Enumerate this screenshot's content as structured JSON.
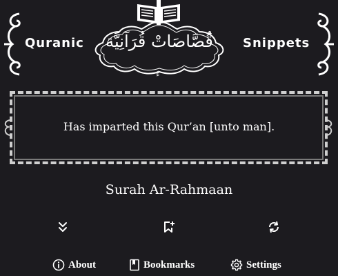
{
  "header": {
    "brand_left": "Quranic",
    "brand_right": "Snippets",
    "arabic_title": "قُصَّاصَاتْ قُرَآنِيَّة",
    "small_mark": "ءَ"
  },
  "verse": {
    "text": "Has imparted this Qur’an [unto man]."
  },
  "surah": {
    "name": "Surah Ar-Rahmaan"
  },
  "actions": {
    "scroll_down_icon": "chevrons-down-icon",
    "bookmark_add_icon": "bookmark-plus-icon",
    "refresh_icon": "refresh-icon"
  },
  "nav": {
    "about_label": "About",
    "bookmarks_label": "Bookmarks",
    "settings_label": "Settings"
  },
  "colors": {
    "background": "#1c1b1f",
    "text": "#ffffff",
    "frame": "#cfcfcf"
  }
}
